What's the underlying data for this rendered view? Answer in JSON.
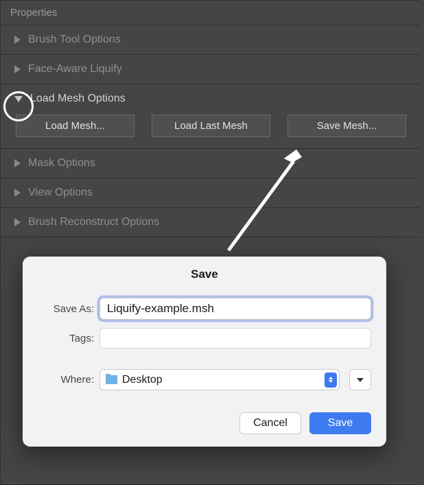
{
  "panel": {
    "title": "Properties",
    "sections": [
      {
        "label": "Brush Tool Options",
        "expanded": false
      },
      {
        "label": "Face-Aware Liquify",
        "expanded": false
      },
      {
        "label": "Load Mesh Options",
        "expanded": true,
        "buttons": [
          "Load Mesh...",
          "Load Last Mesh",
          "Save Mesh..."
        ]
      },
      {
        "label": "Mask Options",
        "expanded": false
      },
      {
        "label": "View Options",
        "expanded": false
      },
      {
        "label": "Brush Reconstruct Options",
        "expanded": false
      }
    ]
  },
  "dialog": {
    "title": "Save",
    "saveAsLabel": "Save As:",
    "saveAsValue": "Liquify-example.msh",
    "tagsLabel": "Tags:",
    "tagsValue": "",
    "whereLabel": "Where:",
    "whereValue": "Desktop",
    "cancel": "Cancel",
    "save": "Save"
  }
}
